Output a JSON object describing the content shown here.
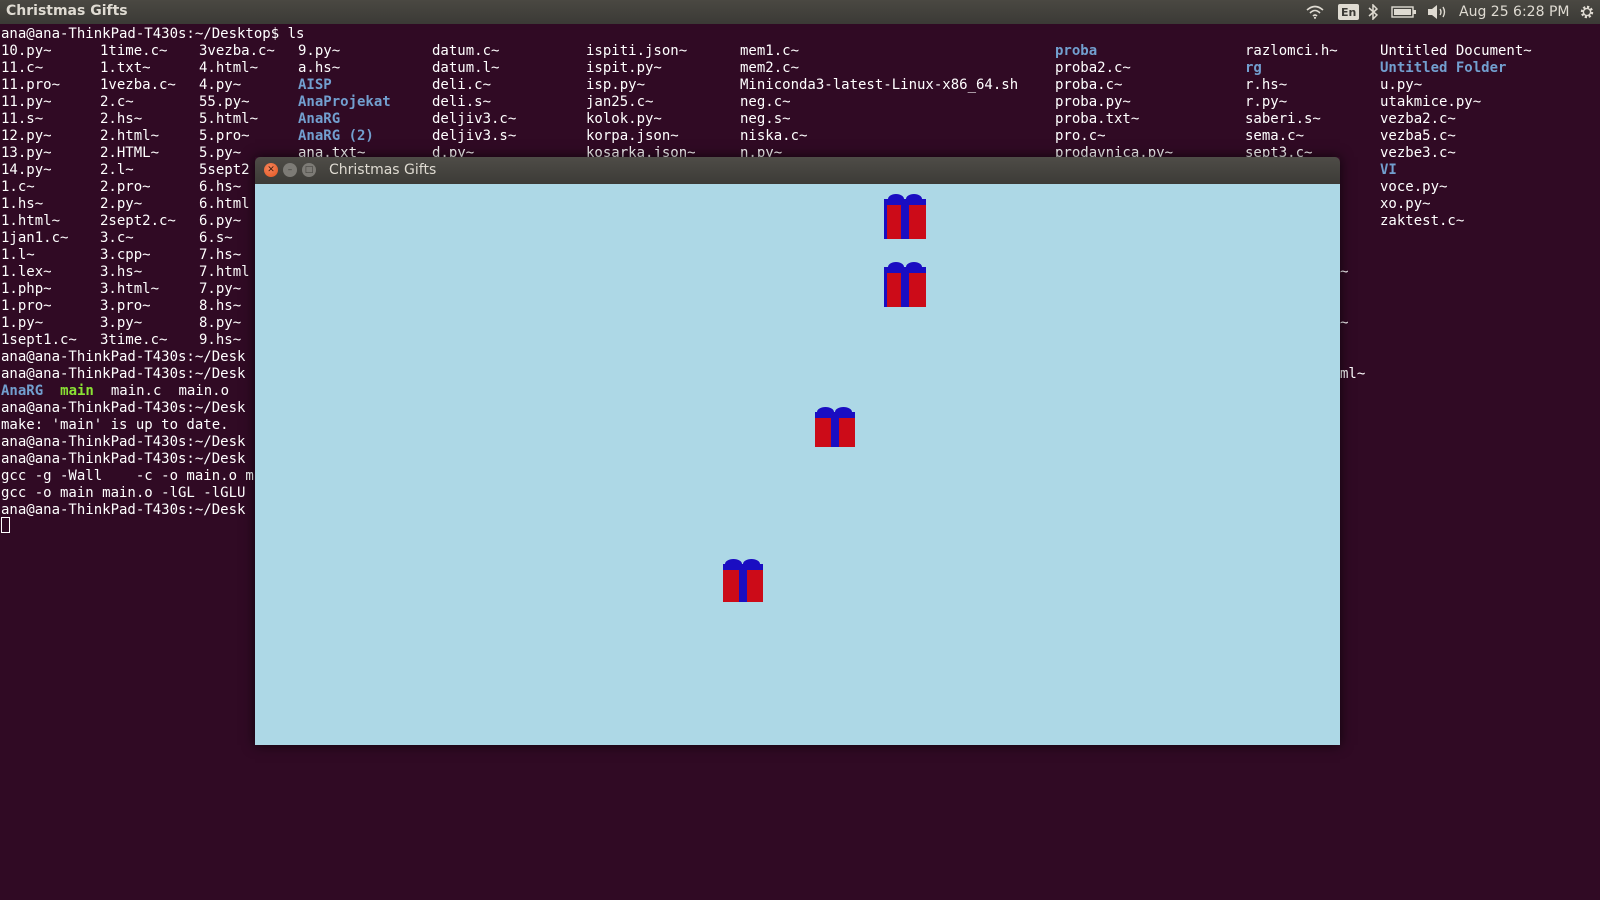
{
  "panel": {
    "app_title": "Christmas Gifts",
    "keyboard_layout": "En",
    "clock": "Aug 25  6:28 PM",
    "icons": [
      "wifi-icon",
      "keyboard-icon",
      "bluetooth-icon",
      "battery-icon",
      "volume-icon",
      "settings-gear-icon"
    ]
  },
  "terminal": {
    "prompt_line": "ana@ana-ThinkPad-T430s:~/Desktop$ ls",
    "columns": [
      [
        "10.py~",
        "11.c~",
        "11.pro~",
        "11.py~",
        "11.s~",
        "12.py~",
        "13.py~",
        "14.py~",
        "1.c~",
        "1.hs~",
        "1.html~",
        "1jan1.c~",
        "1.l~",
        "1.lex~",
        "1.php~",
        "1.pro~",
        "1.py~",
        "1sept1.c~"
      ],
      [
        "1time.c~",
        "1.txt~",
        "1vezba.c~",
        "2.c~",
        "2.hs~",
        "2.html~",
        "2.HTML~",
        "2.l~",
        "2.pro~",
        "2.py~",
        "2sept2.c~",
        "3.c~",
        "3.cpp~",
        "3.hs~",
        "3.html~",
        "3.pro~",
        "3.py~",
        "3time.c~"
      ],
      [
        "3vezba.c~",
        "4.html~",
        "4.py~",
        "55.py~",
        "5.html~",
        "5.pro~",
        "5.py~",
        "5sept2",
        "6.hs~",
        "6.html",
        "6.py~",
        "6.s~",
        "7.hs~",
        "7.html",
        "7.py~",
        "8.hs~",
        "8.py~",
        "9.hs~"
      ],
      [
        "9.py~",
        "a.hs~",
        "AISP",
        "AnaProjekat",
        "AnaRG",
        "AnaRG (2)",
        "ana.txt~"
      ],
      [
        "datum.c~",
        "datum.l~",
        "deli.c~",
        "deli.s~",
        "deljiv3.c~",
        "deljiv3.s~",
        "d.py~"
      ],
      [
        "ispiti.json~",
        "ispit.py~",
        "isp.py~",
        "jan25.c~",
        "kolok.py~",
        "korpa.json~",
        "kosarka.json~"
      ],
      [
        "mem1.c~",
        "mem2.c~",
        "Miniconda3-latest-Linux-x86_64.sh",
        "neg.c~",
        "neg.s~",
        "niska.c~",
        "n.py~"
      ],
      [
        "proba",
        "proba2.c~",
        "proba.c~",
        "proba.py~",
        "proba.txt~",
        "pro.c~",
        "prodavnica.py~"
      ],
      [
        "razlomci.h~",
        "rg",
        "r.hs~",
        "r.py~",
        "saberi.s~",
        "sema.c~",
        "sept3.c~"
      ],
      [
        "Untitled Document~",
        "Untitled Folder",
        "u.py~",
        "utakmice.py~",
        "vezba2.c~",
        "vezba5.c~",
        "vezbe3.c~",
        "VI",
        "voce.py~",
        "xo.py~",
        "zaktest.c~"
      ]
    ],
    "directories": [
      "AISP",
      "AnaProjekat",
      "AnaRG",
      "AnaRG (2)",
      "proba",
      "rg",
      "Untitled Folder",
      "VI"
    ],
    "peek_fragments": [
      "~",
      "~",
      "ml~"
    ],
    "after_lines": [
      {
        "text": "ana@ana-ThinkPad-T430s:~/Desk"
      },
      {
        "text": "ana@ana-ThinkPad-T430s:~/Desk"
      },
      {
        "text": ""
      },
      {
        "text": "ana@ana-ThinkPad-T430s:~/Desk"
      },
      {
        "text": "make: 'main' is up to date."
      },
      {
        "text": "ana@ana-ThinkPad-T430s:~/Desk"
      },
      {
        "text": "ana@ana-ThinkPad-T430s:~/Desk"
      },
      {
        "text": "gcc -g -Wall    -c -o main.o m"
      },
      {
        "text": "gcc -o main main.o -lGL -lGLU"
      },
      {
        "text": "ana@ana-ThinkPad-T430s:~/Desk"
      }
    ],
    "ls_main": [
      {
        "text": "AnaRG",
        "kind": "dir"
      },
      {
        "text": "main",
        "kind": "exec"
      },
      {
        "text": "main.c",
        "kind": "file"
      },
      {
        "text": "main.o",
        "kind": "file"
      }
    ]
  },
  "window": {
    "title": "Christmas Gifts",
    "background": "#add8e6",
    "gift_color": "#cc0b18",
    "ribbon_color": "#1a0dc2"
  }
}
